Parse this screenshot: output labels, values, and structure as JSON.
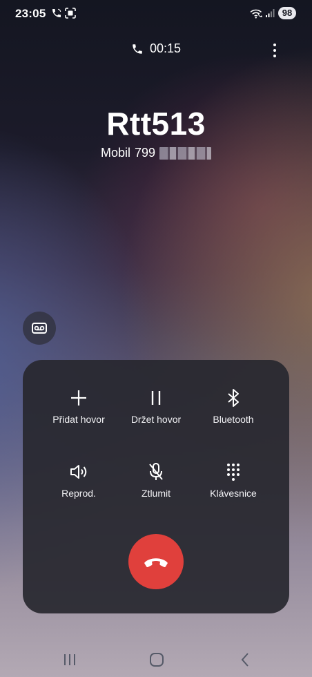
{
  "status_bar": {
    "time": "23:05",
    "battery": "98",
    "icons": [
      "phone-call-icon",
      "screen-record-icon",
      "wifi-calling-icon",
      "signal-icon"
    ]
  },
  "call": {
    "timer": "00:15",
    "caller_name": "Rtt513",
    "number_label": "Mobil",
    "number_prefix": "799"
  },
  "controls": [
    {
      "label": "Přidat hovor",
      "icon": "plus-icon"
    },
    {
      "label": "Držet hovor",
      "icon": "pause-icon"
    },
    {
      "label": "Bluetooth",
      "icon": "bluetooth-icon"
    },
    {
      "label": "Reprod.",
      "icon": "speaker-icon"
    },
    {
      "label": "Ztlumit",
      "icon": "mic-off-icon"
    },
    {
      "label": "Klávesnice",
      "icon": "keypad-icon"
    }
  ],
  "colors": {
    "end_call": "#e0403c",
    "panel": "#28282f",
    "text": "#ffffff"
  }
}
